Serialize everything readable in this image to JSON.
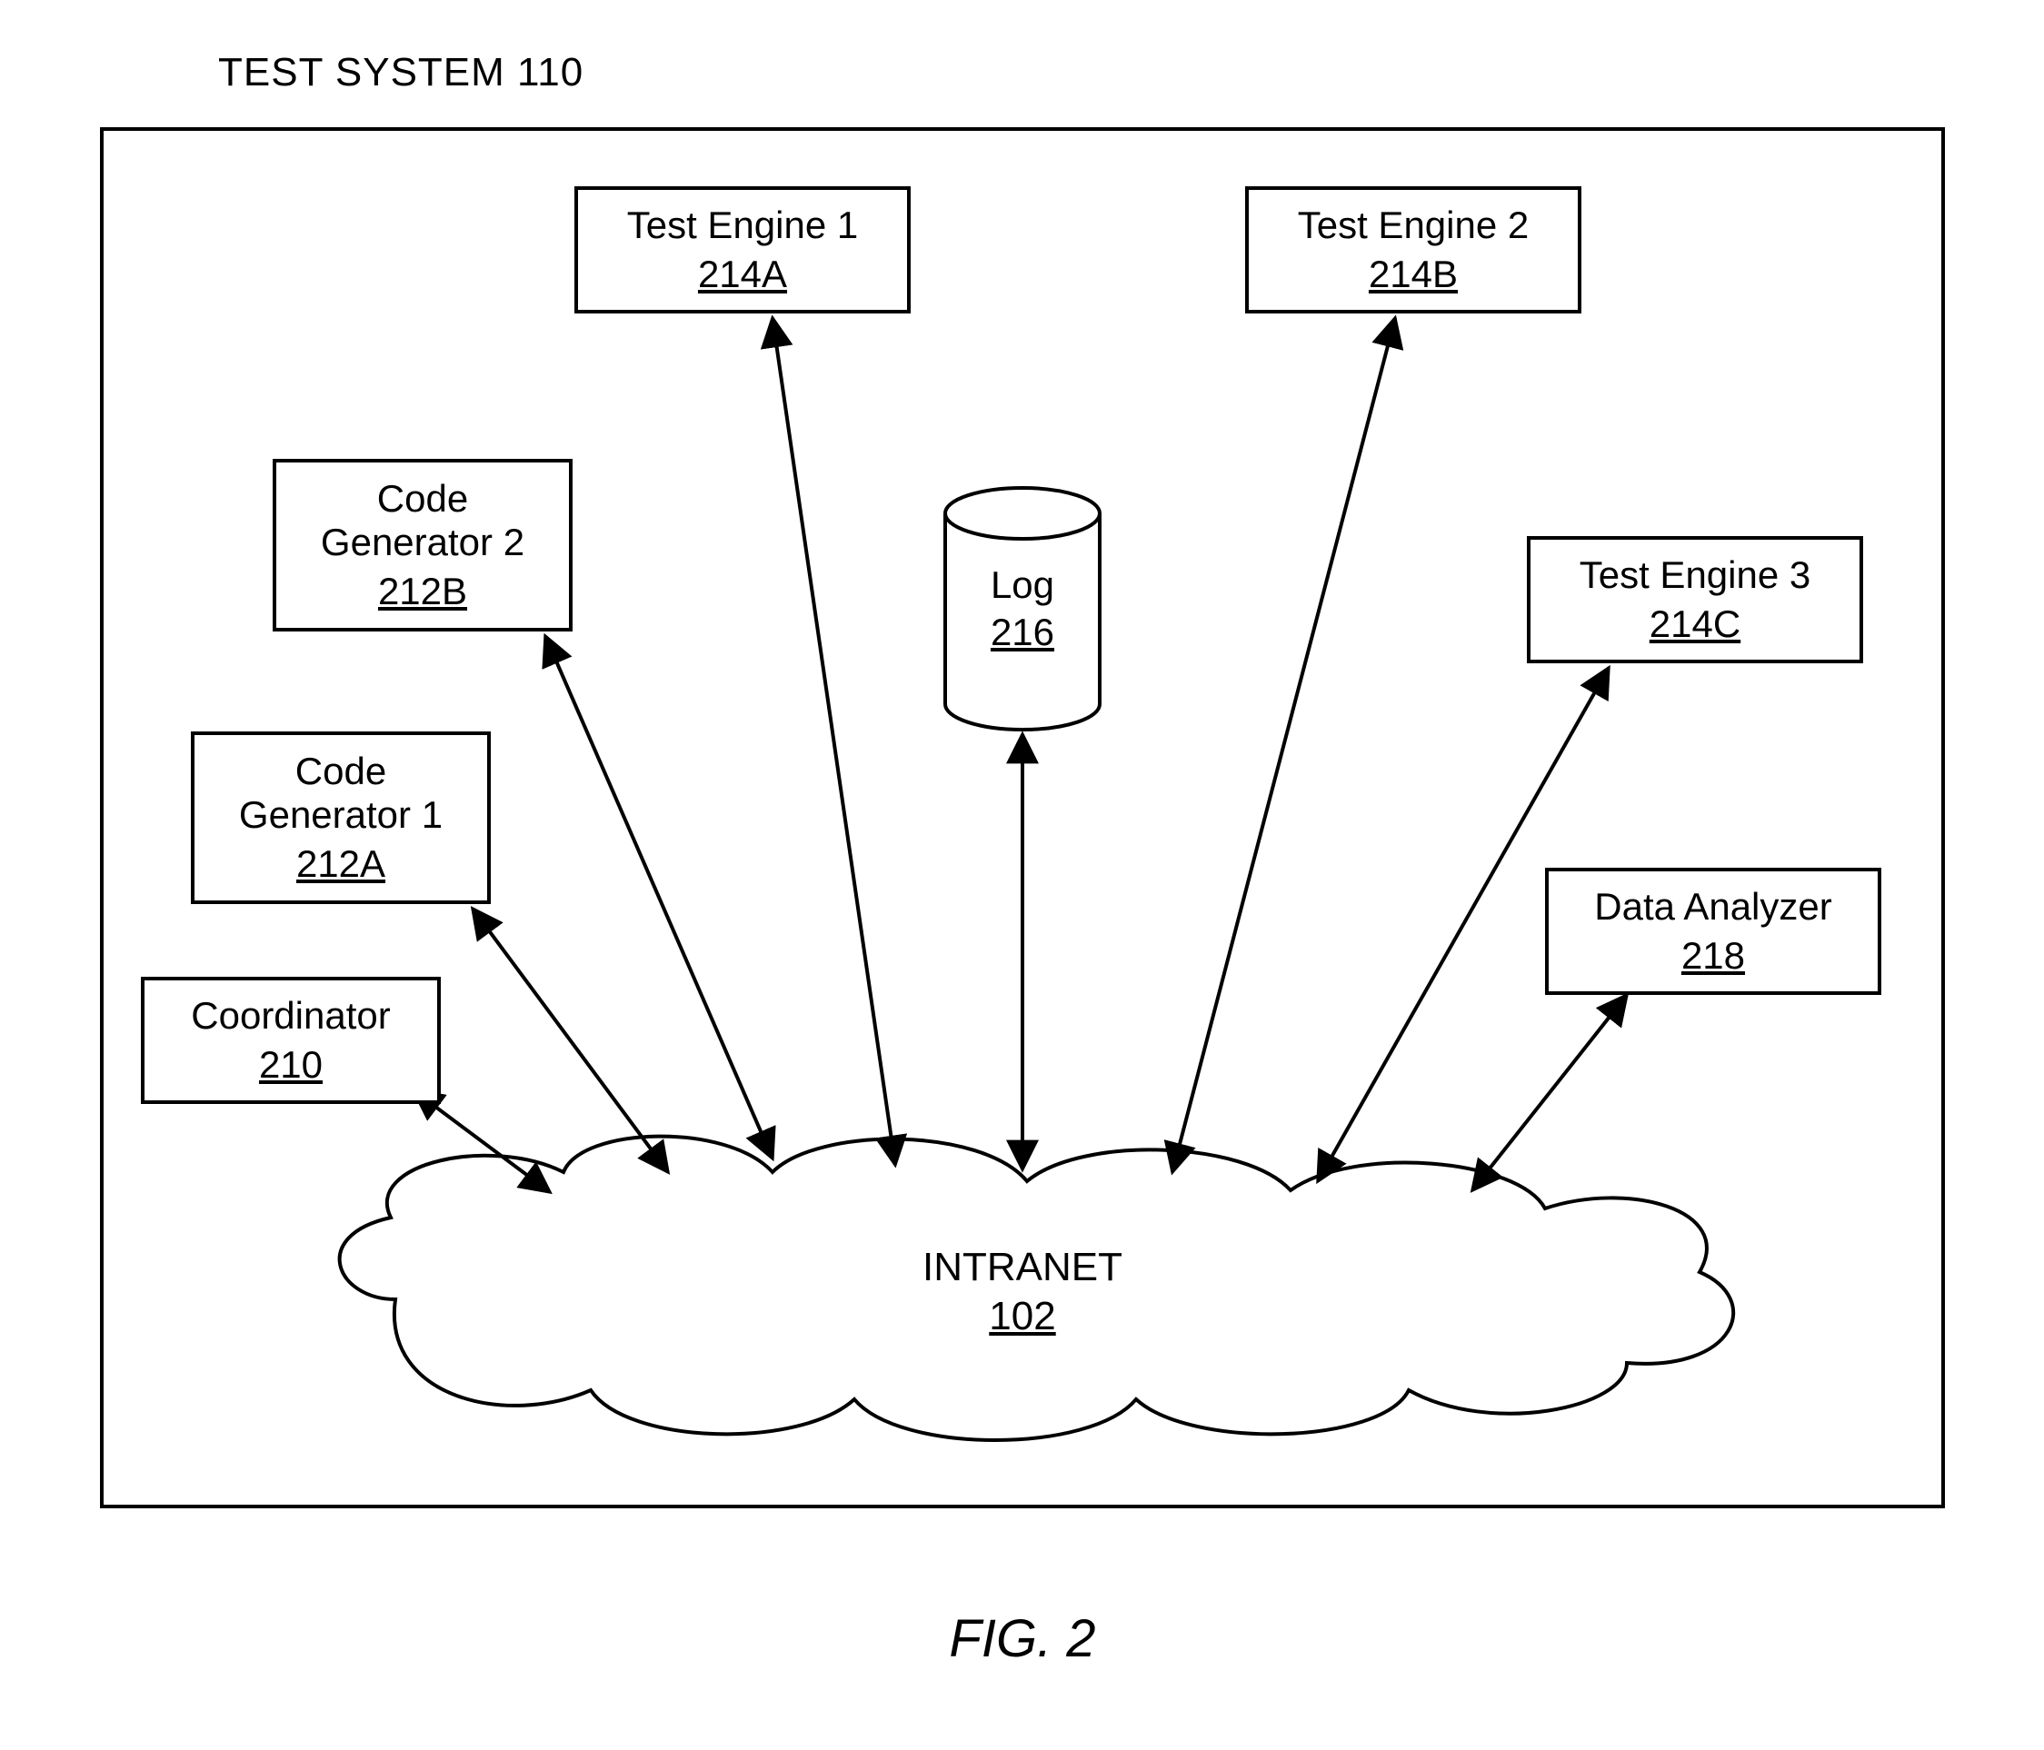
{
  "title": "TEST SYSTEM 110",
  "figure_caption": "FIG. 2",
  "cloud": {
    "label": "INTRANET",
    "ref": "102"
  },
  "log": {
    "label": "Log",
    "ref": "216"
  },
  "nodes": {
    "coordinator": {
      "line1": "Coordinator",
      "line2": "",
      "ref": "210"
    },
    "codegen1": {
      "line1": "Code",
      "line2": "Generator 1",
      "ref": "212A"
    },
    "codegen2": {
      "line1": "Code",
      "line2": "Generator 2",
      "ref": "212B"
    },
    "test1": {
      "line1": "Test Engine 1",
      "line2": "",
      "ref": "214A"
    },
    "test2": {
      "line1": "Test Engine 2",
      "line2": "",
      "ref": "214B"
    },
    "test3": {
      "line1": "Test Engine 3",
      "line2": "",
      "ref": "214C"
    },
    "analyzer": {
      "line1": "Data Analyzer",
      "line2": "",
      "ref": "218"
    }
  }
}
